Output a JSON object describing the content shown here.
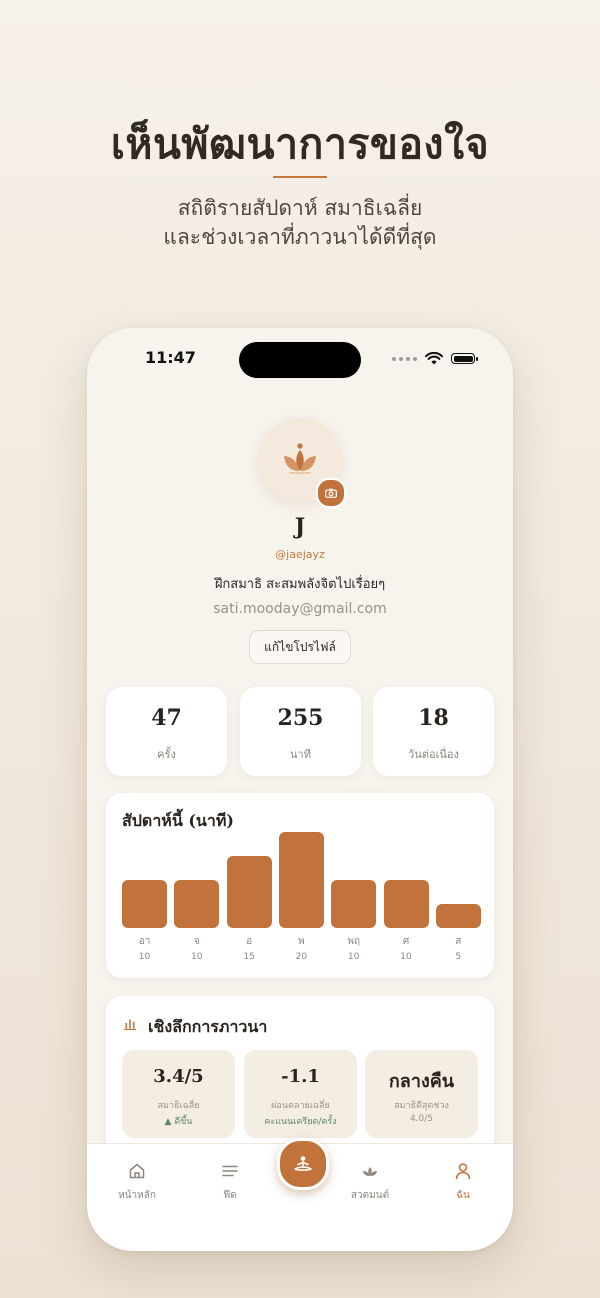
{
  "hero": {
    "title": "เห็นพัฒนาการของใจ",
    "subtitle_line1": "สถิติรายสัปดาห์ สมาธิเฉลี่ย",
    "subtitle_line2": "และช่วงเวลาที่ภาวนาได้ดีที่สุด"
  },
  "status_bar": {
    "time": "11:47"
  },
  "profile": {
    "name": "J",
    "handle": "@jaejayz",
    "bio": "ฝึกสมาธิ สะสมพลังจิตไปเรื่อยๆ",
    "email": "sati.mooday@gmail.com",
    "edit_button": "แก้ไขโปรไฟล์"
  },
  "stats": [
    {
      "value": "47",
      "label": "ครั้ง"
    },
    {
      "value": "255",
      "label": "นาที"
    },
    {
      "value": "18",
      "label": "วันต่อเนื่อง"
    }
  ],
  "weekly": {
    "title": "สัปดาห์นี้ (นาที)"
  },
  "chart_data": {
    "type": "bar",
    "title": "สัปดาห์นี้ (นาที)",
    "categories": [
      "อา",
      "จ",
      "อ",
      "พ",
      "พฤ",
      "ศ",
      "ส"
    ],
    "values": [
      10,
      10,
      15,
      20,
      10,
      10,
      5
    ],
    "ylim": [
      0,
      20
    ]
  },
  "insights": {
    "title": "เชิงลึกการภาวนา",
    "items": [
      {
        "value": "3.4/5",
        "label": "สมาธิเฉลี่ย",
        "note": "▲ ดีขึ้น"
      },
      {
        "value": "-1.1",
        "label": "ผ่อนคลายเฉลี่ย",
        "note": "คะแนนเครียด/ครั้ง"
      },
      {
        "value": "กลางคืน",
        "label": "สมาธิดีสุดช่วง",
        "note": "4.0/5"
      }
    ]
  },
  "tabs": [
    {
      "label": "หน้าหลัก",
      "icon": "home-icon"
    },
    {
      "label": "ฟีด",
      "icon": "feed-icon"
    },
    {
      "label": "สวดมนต์",
      "icon": "lotus-icon"
    },
    {
      "label": "ฉัน",
      "icon": "person-icon"
    }
  ],
  "colors": {
    "accent": "#c1733b",
    "positive": "#5b8a5e"
  }
}
